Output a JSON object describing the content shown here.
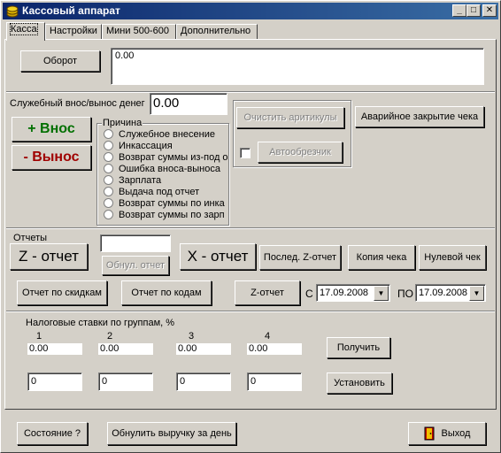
{
  "window": {
    "title": "Кассовый аппарат",
    "min": "_",
    "max": "□",
    "close": "✕"
  },
  "tabs": [
    "Касса",
    "Настройки",
    "Мини 500-600",
    "Дополнительно"
  ],
  "turnover": {
    "button": "Оборот",
    "value": "0.00"
  },
  "service": {
    "label": "Служебный внос/вынос денег",
    "amount": "0.00",
    "deposit": "+ Внос",
    "withdraw": "- Вынос",
    "reason_title": "Причина",
    "reasons": [
      "Служебное внесение",
      "Инкассация",
      "Возврат суммы из-под о",
      "Ошибка вноса-выноса",
      "Зарплата",
      "Выдача под отчет",
      "Возврат суммы по инка",
      "Возврат суммы по зарп"
    ],
    "clear_articles": "Очистить аритикулы",
    "emergency_close": "Аварийное закрытие чека",
    "autocut": "Автообрезчик"
  },
  "reports": {
    "label": "Отчеты",
    "z_report": "Z - отчет",
    "reset_report": "Обнул. отчет",
    "x_report": "X - отчет",
    "last_z": "Послед. Z-отчет",
    "copy_receipt": "Копия чека",
    "zero_receipt": "Нулевой чек",
    "by_discounts": "Отчет по скидкам",
    "by_codes": "Отчет по кодам",
    "z_period": "Z-отчет",
    "from_label": "С",
    "from_date": "17.09.2008",
    "to_label": "ПО",
    "to_date": "17.09.2008"
  },
  "tax": {
    "label": "Налоговые ставки по группам, %",
    "groups": [
      "1",
      "2",
      "3",
      "4"
    ],
    "current": [
      "0.00",
      "0.00",
      "0.00",
      "0.00"
    ],
    "inputs": [
      "0",
      "0",
      "0",
      "0"
    ],
    "get": "Получить",
    "set": "Установить"
  },
  "footer": {
    "state": "Состояние ?",
    "reset_revenue": "Обнулить выручку за день",
    "exit": "Выход"
  }
}
